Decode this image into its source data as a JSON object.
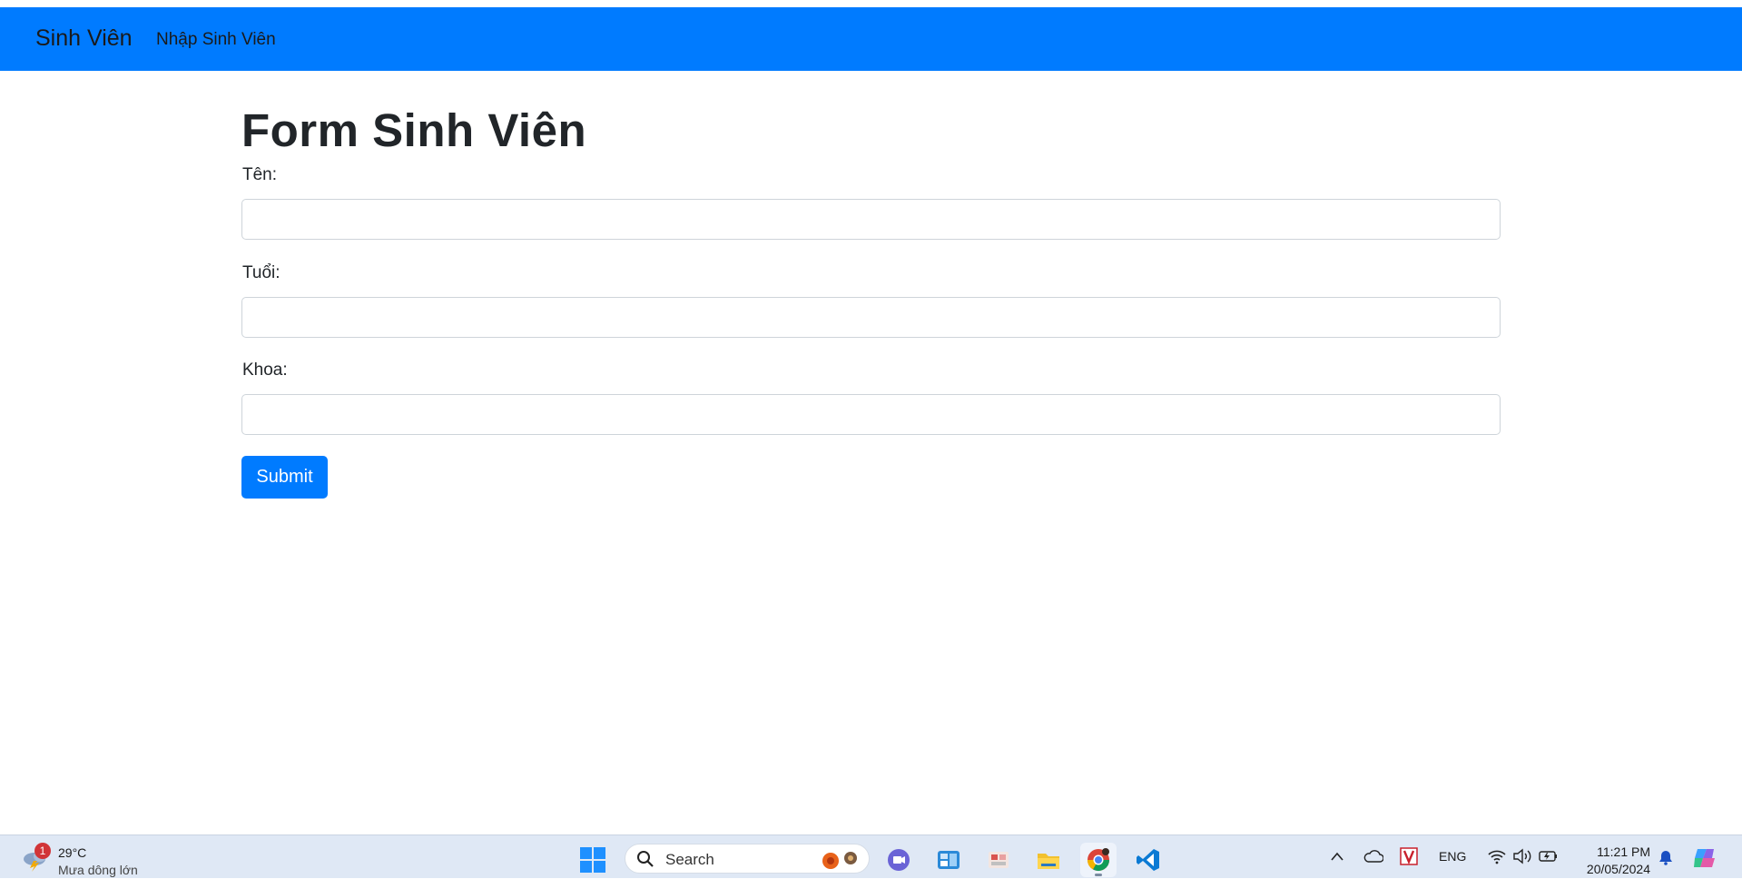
{
  "navbar": {
    "brand": "Sinh Viên",
    "link": "Nhập Sinh Viên",
    "bg_color": "#007bff"
  },
  "form": {
    "title": "Form Sinh Viên",
    "fields": [
      {
        "label": "Tên:",
        "value": "",
        "placeholder": ""
      },
      {
        "label": "Tuổi:",
        "value": "",
        "placeholder": ""
      },
      {
        "label": "Khoa:",
        "value": "",
        "placeholder": ""
      }
    ],
    "submit_label": "Submit",
    "button_color": "#007bff"
  },
  "taskbar": {
    "weather": {
      "badge": "1",
      "temperature": "29°C",
      "condition": "Mưa dông lớn",
      "icon": "thunderstorm-icon"
    },
    "search_placeholder": "Search",
    "apps": [
      "start-icon",
      "teams-icon",
      "widgets-icon",
      "media-icon",
      "file-explorer-icon",
      "chrome-icon",
      "vscode-icon"
    ],
    "tray": {
      "language": "ENG",
      "time": "11:21 PM",
      "date": "20/05/2024"
    }
  }
}
